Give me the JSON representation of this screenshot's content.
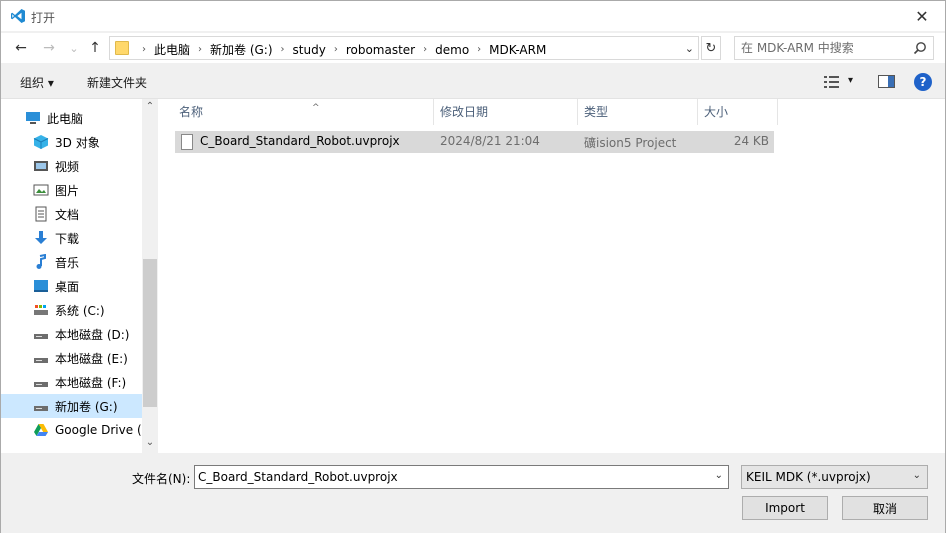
{
  "titlebar": {
    "title": "打开",
    "close_glyph": "✕"
  },
  "nav": {
    "back": "←",
    "forward": "→",
    "recent": "⌄",
    "up": "↑",
    "refresh": "↻"
  },
  "address": {
    "crumbs": [
      "此电脑",
      "新加卷 (G:)",
      "study",
      "robomaster",
      "demo",
      "MDK-ARM"
    ],
    "separator": "›",
    "dropdown": "⌄"
  },
  "search": {
    "placeholder": "在 MDK-ARM 中搜索"
  },
  "toolbar": {
    "organize": "组织 ▾",
    "new_folder": "新建文件夹",
    "view_dd": "▾",
    "help": "?"
  },
  "sidebar": {
    "items": [
      {
        "label": "此电脑",
        "icon": "computer-icon"
      },
      {
        "label": "3D 对象",
        "icon": "3d-objects-icon"
      },
      {
        "label": "视频",
        "icon": "videos-icon"
      },
      {
        "label": "图片",
        "icon": "pictures-icon"
      },
      {
        "label": "文档",
        "icon": "documents-icon"
      },
      {
        "label": "下载",
        "icon": "downloads-icon"
      },
      {
        "label": "音乐",
        "icon": "music-icon"
      },
      {
        "label": "桌面",
        "icon": "desktop-icon"
      },
      {
        "label": "系统 (C:)",
        "icon": "system-drive-icon"
      },
      {
        "label": "本地磁盘 (D:)",
        "icon": "drive-icon"
      },
      {
        "label": "本地磁盘 (E:)",
        "icon": "drive-icon"
      },
      {
        "label": "本地磁盘 (F:)",
        "icon": "drive-icon"
      },
      {
        "label": "新加卷 (G:)",
        "icon": "drive-icon"
      },
      {
        "label": "Google Drive (",
        "icon": "google-drive-icon"
      }
    ],
    "selected_index": 12,
    "scroll_up": "⌃",
    "scroll_down": "⌄"
  },
  "filelist": {
    "columns": [
      "名称",
      "修改日期",
      "类型",
      "大小"
    ],
    "sort_caret": "^",
    "rows": [
      {
        "name": "C_Board_Standard_Robot.uvprojx",
        "date": "2024/8/21 21:04",
        "type": "礦ision5 Project",
        "size": "24 KB"
      }
    ]
  },
  "bottom": {
    "filename_label": "文件名(N):",
    "filename_value": "C_Board_Standard_Robot.uvprojx",
    "filetype": "KEIL MDK (*.uvprojx)",
    "dropdown": "⌄",
    "import_label": "Import",
    "cancel_label": "取消"
  },
  "colors": {
    "selected": "#cce8ff",
    "accent": "#1f62c9",
    "header_text": "#4c607a"
  }
}
